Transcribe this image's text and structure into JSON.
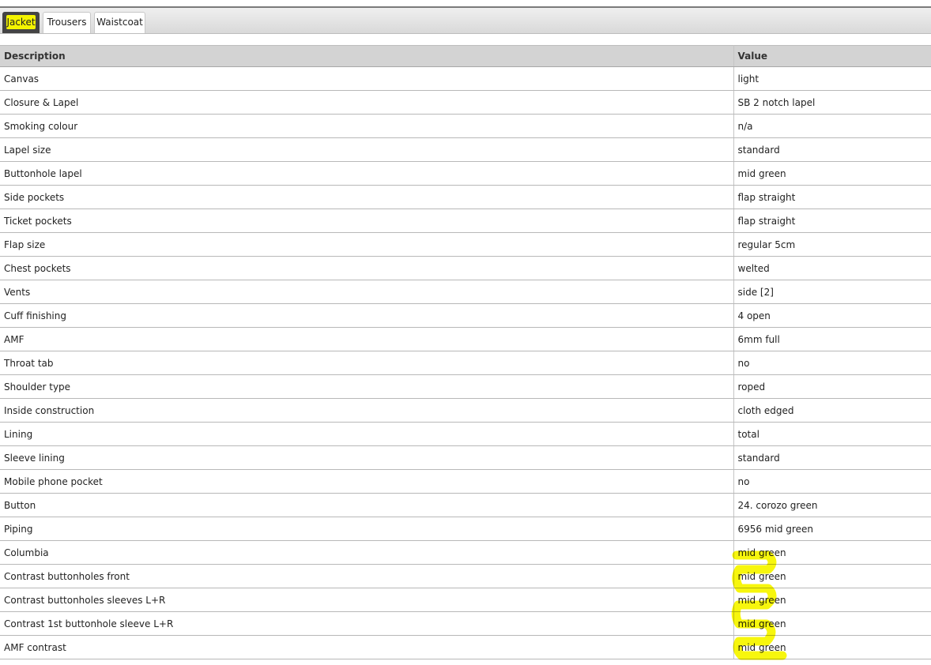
{
  "tabs": [
    {
      "label": "Jacket",
      "active": true
    },
    {
      "label": "Trousers",
      "active": false
    },
    {
      "label": "Waistcoat",
      "active": false
    }
  ],
  "table": {
    "headers": {
      "description": "Description",
      "value": "Value"
    },
    "rows": [
      {
        "description": "Canvas",
        "value": "light"
      },
      {
        "description": "Closure & Lapel",
        "value": "SB 2 notch lapel"
      },
      {
        "description": "Smoking colour",
        "value": "n/a"
      },
      {
        "description": "Lapel size",
        "value": "standard"
      },
      {
        "description": "Buttonhole lapel",
        "value": "mid green"
      },
      {
        "description": "Side pockets",
        "value": "flap straight"
      },
      {
        "description": "Ticket pockets",
        "value": "flap straight"
      },
      {
        "description": "Flap size",
        "value": "regular 5cm"
      },
      {
        "description": "Chest pockets",
        "value": "welted"
      },
      {
        "description": "Vents",
        "value": "side [2]"
      },
      {
        "description": "Cuff finishing",
        "value": "4 open"
      },
      {
        "description": "AMF",
        "value": "6mm full"
      },
      {
        "description": "Throat tab",
        "value": "no"
      },
      {
        "description": "Shoulder type",
        "value": "roped"
      },
      {
        "description": "Inside construction",
        "value": "cloth edged"
      },
      {
        "description": "Lining",
        "value": "total"
      },
      {
        "description": "Sleeve lining",
        "value": "standard"
      },
      {
        "description": "Mobile phone pocket",
        "value": "no"
      },
      {
        "description": "Button",
        "value": "24. corozo green"
      },
      {
        "description": "Piping",
        "value": "6956 mid green"
      },
      {
        "description": "Columbia",
        "value": "mid green"
      },
      {
        "description": "Contrast buttonholes front",
        "value": "mid green"
      },
      {
        "description": "Contrast buttonholes sleeves L+R",
        "value": "mid green"
      },
      {
        "description": "Contrast 1st buttonhole sleeve L+R",
        "value": "mid green"
      },
      {
        "description": "AMF contrast",
        "value": "mid green"
      }
    ]
  },
  "colors": {
    "highlight": "#f7f600",
    "active_tab": "#444444",
    "header_bg": "#d3d3d3"
  }
}
